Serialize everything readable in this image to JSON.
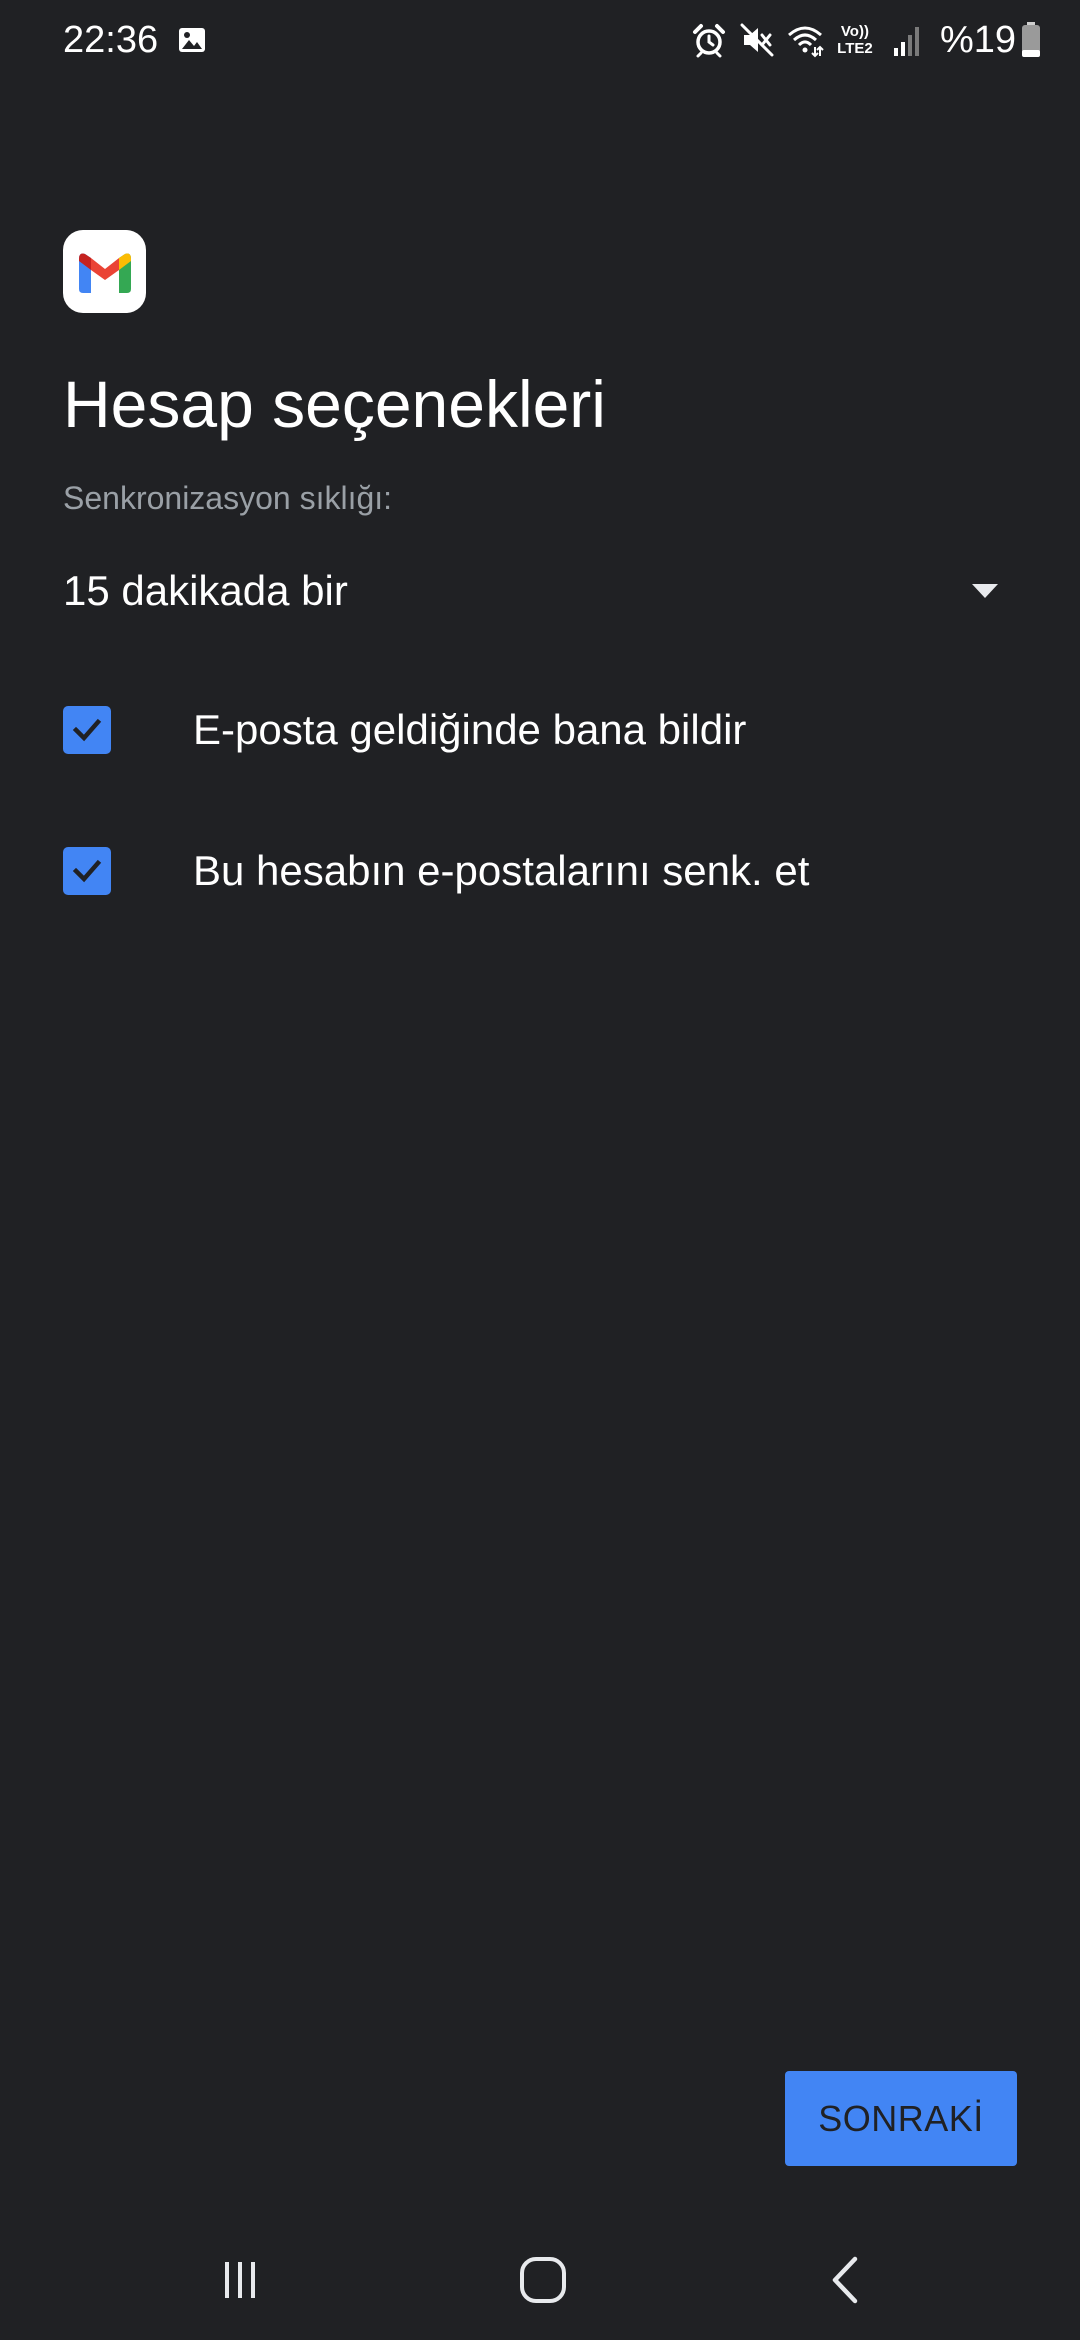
{
  "status_bar": {
    "time": "22:36",
    "volte_top": "Vo))",
    "volte_bottom": "LTE2",
    "battery": "%19",
    "icons": [
      "gallery-icon",
      "alarm-icon",
      "mute-icon",
      "wifi-icon",
      "volte-lte-icon",
      "signal-icon",
      "battery-icon"
    ]
  },
  "app": {
    "logo": "gmail-logo-icon"
  },
  "page": {
    "title": "Hesap seçenekleri",
    "sync_label": "Senkronizasyon sıklığı:",
    "sync_value": "15 dakikada bir"
  },
  "options": [
    {
      "label": "E-posta geldiğinde bana bildir",
      "checked": true
    },
    {
      "label": "Bu hesabın e-postalarını senk. et",
      "checked": true
    }
  ],
  "actions": {
    "next_label": "SONRAKİ"
  },
  "nav": {
    "icons": [
      "recents-icon",
      "home-icon",
      "back-icon"
    ]
  },
  "colors": {
    "background": "#202124",
    "accent": "#4285f4",
    "secondary_text": "#9aa0a6"
  }
}
